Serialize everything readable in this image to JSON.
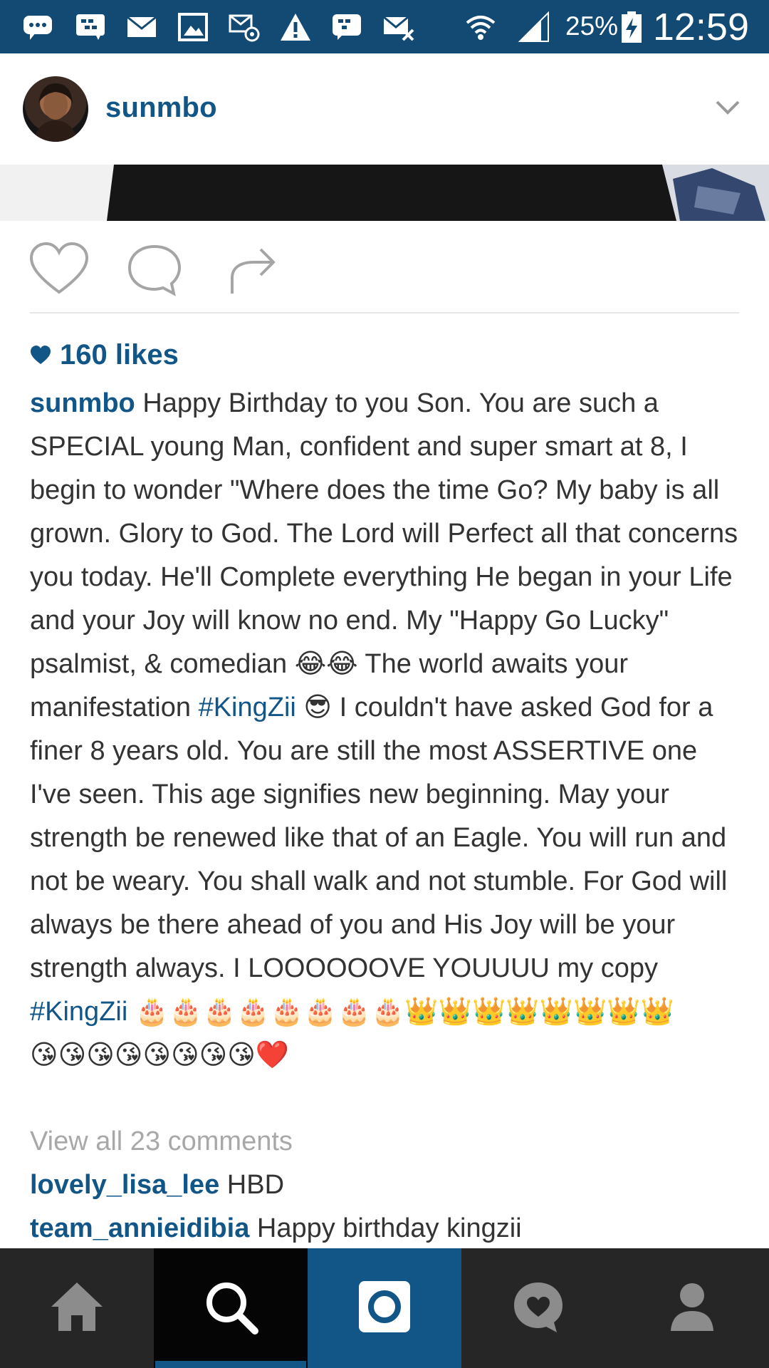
{
  "status_bar": {
    "battery": "25%",
    "time": "12:59",
    "icons": [
      "chat-bubble-icon",
      "bbm-icon",
      "mail-icon",
      "gallery-icon",
      "email-at-icon",
      "warning-icon",
      "bbm-icon",
      "mail-off-icon",
      "wifi-icon",
      "signal-icon",
      "battery-charging-icon"
    ]
  },
  "post": {
    "username": "sunmbo",
    "menu_icon": "chevron-down-icon",
    "actions": [
      "heart-icon",
      "comment-icon",
      "share-icon"
    ],
    "likes": "160 likes",
    "caption": {
      "username": "sunmbo",
      "text_1": " Happy Birthday to you Son. You are such a SPECIAL young Man, confident and super smart at 8, I begin to wonder \"Where does the time Go? My baby is all grown. Glory to God. The Lord will Perfect all that concerns you today. He'll Complete everything He began in your Life and your Joy will know no end. My \"Happy Go Lucky\" psalmist, & comedian ",
      "emoji_1": "😂😂",
      "text_2": " The world awaits your manifestation ",
      "hashtag_1": "#KingZii",
      "emoji_2": " 😎",
      "text_3": " I couldn't have asked God for a finer 8 years old. You are still the most ASSERTIVE one I've seen. This age signifies new beginning. May your strength be renewed like that of an Eagle. You will run and not be weary. You shall walk and not stumble. For God will always be there ahead of you and His Joy will be your strength always. I LOOOOOOVE YOUUUU my copy ",
      "hashtag_2": "#KingZii",
      "emoji_3": " 🎂🎂🎂🎂🎂🎂🎂🎂👑👑👑👑👑👑👑👑",
      "emoji_4": "😘😘😘😘😘😘😘😘❤️"
    },
    "view_all_comments": "View all 23 comments",
    "comments": [
      {
        "username": "lovely_lisa_lee",
        "text": " HBD"
      },
      {
        "username": "team_annieidibia",
        "text": " Happy birthday kingzii"
      }
    ]
  },
  "bottom_nav": {
    "items": [
      "home-icon",
      "search-icon",
      "camera-icon",
      "activity-heart-icon",
      "profile-icon"
    ],
    "active": "search",
    "colors": {
      "bar": "#262626",
      "active_bg": "#050505",
      "accent": "#125688"
    }
  },
  "colors": {
    "status_bar": "#124a73",
    "link": "#125688",
    "text": "#333333",
    "muted": "#a8a8a8"
  }
}
